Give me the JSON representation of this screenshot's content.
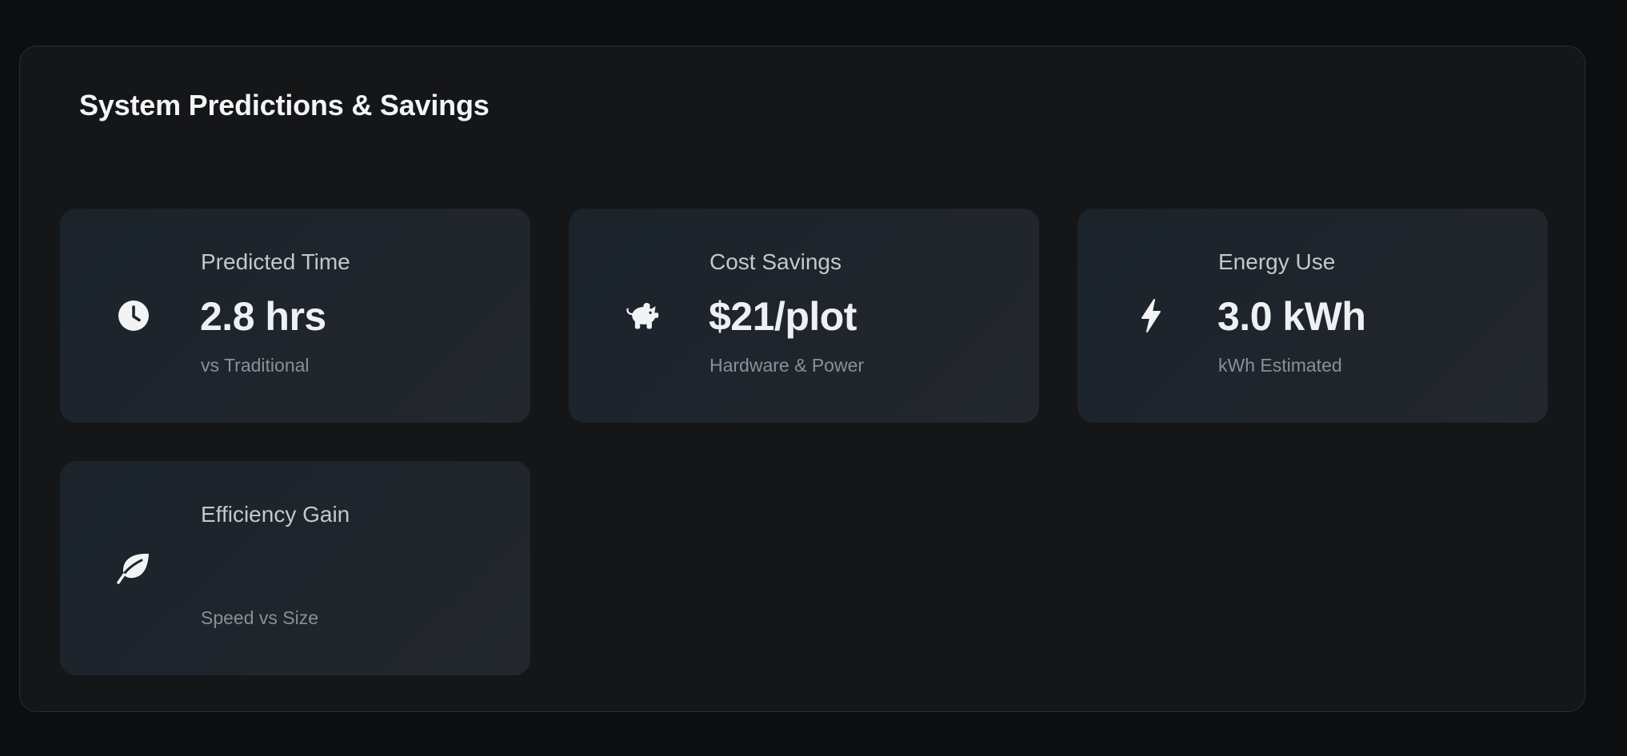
{
  "panel": {
    "title": "System Predictions & Savings"
  },
  "cards": [
    {
      "icon": "clock-icon",
      "label": "Predicted Time",
      "value": "2.8 hrs",
      "sub": "vs Traditional"
    },
    {
      "icon": "piggy-bank-icon",
      "label": "Cost Savings",
      "value": "$21/plot",
      "sub": "Hardware & Power"
    },
    {
      "icon": "lightning-bolt-icon",
      "label": "Energy Use",
      "value": "3.0 kWh",
      "sub": "kWh Estimated"
    },
    {
      "icon": "leaf-icon",
      "label": "Efficiency Gain",
      "value": "",
      "sub": "Speed vs Size"
    }
  ],
  "colors": {
    "page_background": "#0c0e10",
    "panel_background": "#141618",
    "panel_border": "#2a2d31",
    "card_background": "#1f252c",
    "title_text": "#f3f4f6",
    "label_text": "#c4c8ce",
    "value_text": "#eef0f3",
    "sub_text": "#8b9098",
    "icon": "#f2f3f5"
  }
}
